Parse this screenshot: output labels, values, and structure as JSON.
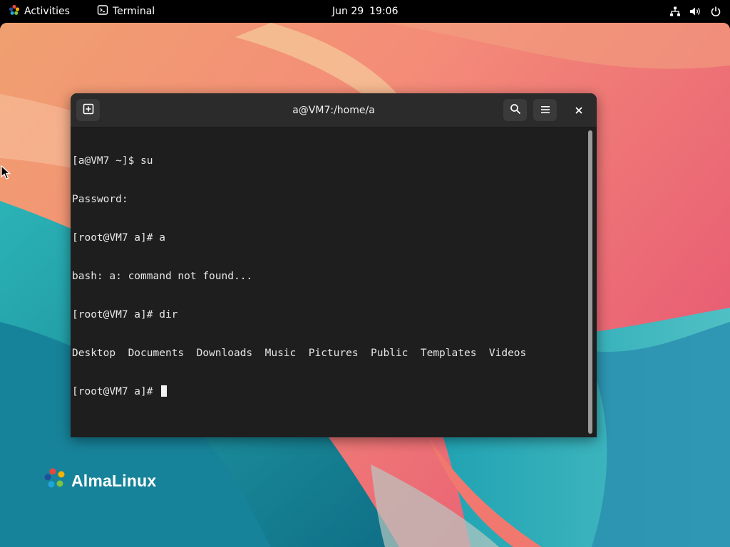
{
  "topbar": {
    "activities_label": "Activities",
    "app_name": "Terminal",
    "date": "Jun 29",
    "time": "19:06"
  },
  "desktop": {
    "brand_name": "AlmaLinux"
  },
  "terminal": {
    "title": "a@VM7:/home/a",
    "lines": [
      "[a@VM7 ~]$ su",
      "Password:",
      "[root@VM7 a]# a",
      "bash: a: command not found...",
      "[root@VM7 a]# dir",
      "Desktop  Documents  Downloads  Music  Pictures  Public  Templates  Videos",
      "[root@VM7 a]# "
    ]
  },
  "colors": {
    "topbar_bg": "#000000",
    "terminal_bg": "#1e1e1e",
    "header_bg": "#2b2b2b",
    "text": "#e6e6e6"
  },
  "icons": {
    "activities": "almalinux-logo-icon",
    "app": "terminal-icon",
    "network": "network-icon",
    "volume": "volume-icon",
    "power": "power-icon",
    "new_tab": "new-tab-icon",
    "search": "search-icon",
    "menu": "hamburger-menu-icon",
    "close": "close-icon"
  }
}
